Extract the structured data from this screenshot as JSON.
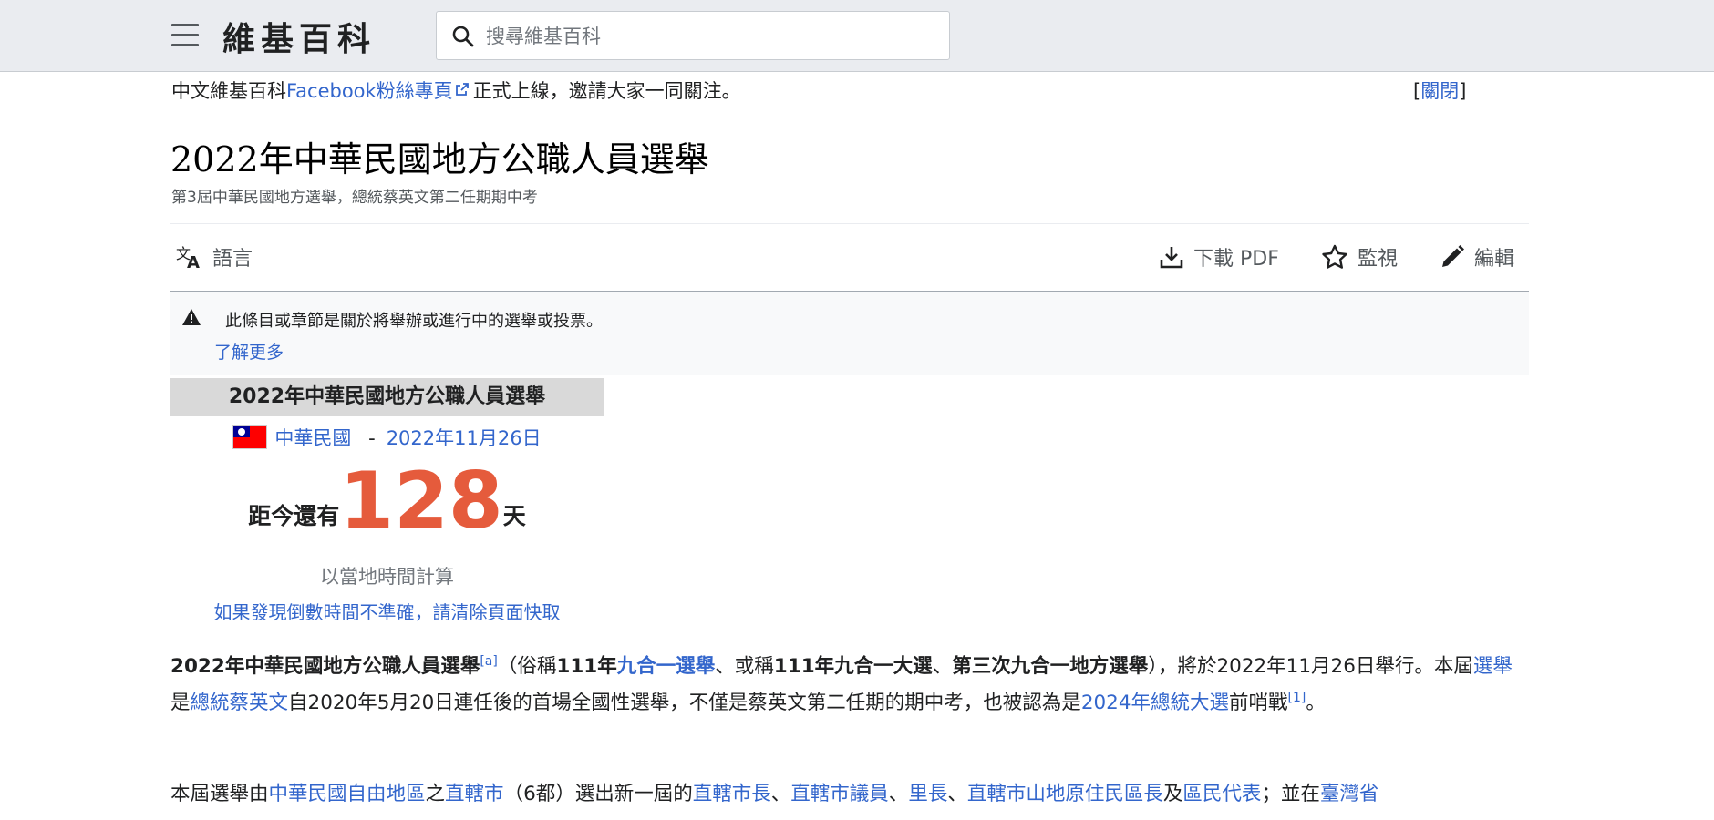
{
  "header": {
    "wordmark": "維基百科",
    "search_placeholder": "搜尋維基百科"
  },
  "notice": {
    "prefix": "中文維基百科",
    "link": "Facebook粉絲專頁",
    "suffix": "正式上線，邀請大家一同關注。",
    "close_open": "[",
    "close_label": "關閉",
    "close_end": "]"
  },
  "page": {
    "title": "2022年中華民國地方公職人員選舉",
    "tagline": "第3屆中華民國地方選舉，總統蔡英文第二任期期中考"
  },
  "toolbar": {
    "language": "語言",
    "download": "下載 PDF",
    "watch": "監視",
    "edit": "編輯"
  },
  "ambox": {
    "message": "此條目或章節是關於將舉辦或進行中的選舉或投票。",
    "more": "了解更多"
  },
  "countdown": {
    "header": "2022年中華民國地方公職人員選舉",
    "country": "中華民國",
    "dash": "-",
    "date": "2022年11月26日",
    "prefix": "距今還有",
    "days": "128",
    "suffix": "天",
    "note": "以當地時間計算",
    "purge": "如果發現倒數時間不準確，請清除頁面快取"
  },
  "article": {
    "p1": {
      "t1": "2022年中華民國地方公職人員選舉",
      "ref_a": "[a]",
      "t2": "（俗稱",
      "t3": "111年",
      "link1": "九合一選舉",
      "t4": "、或稱",
      "t5": "111年九合一大選",
      "t6": "、",
      "t7": "第三次九合一地方選舉",
      "t8": "），將於2022年11月26日舉行。本屆",
      "link2": "選舉",
      "t9": "是",
      "link3": "總統",
      "link4": "蔡英文",
      "t10": "自2020年5月20日連任後的首場全國性選舉，不僅是蔡英文第二任期的期中考，也被認為是",
      "link5": "2024年總統大選",
      "t11": "前哨戰",
      "ref_1": "[1]",
      "t12": "。"
    },
    "p2": {
      "t1": "本屆選舉由",
      "link1": "中華民國自由地區",
      "t2": "之",
      "link2": "直轄市",
      "t3": "（6都）選出新一屆的",
      "link3": "直轄市長",
      "t4": "、",
      "link4": "直轄市議員",
      "t5": "、",
      "link5": "里長",
      "t6": "、",
      "link6": "直轄市山地原住民區長",
      "t7": "及",
      "link7": "區民代表",
      "t8": "；並在",
      "link8": "臺灣省"
    }
  },
  "colors": {
    "link": "#3366cc",
    "countdown_number": "#e55b3c",
    "header_bg": "#eaecf0"
  }
}
